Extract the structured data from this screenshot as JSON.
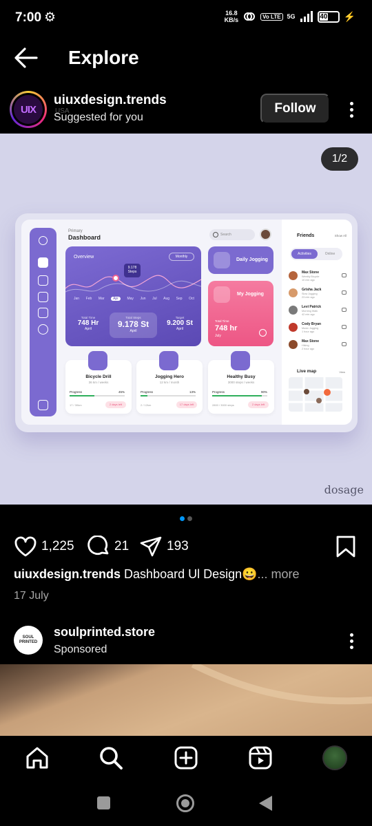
{
  "status_bar": {
    "time": "7:00",
    "net_speed_top": "16.8",
    "net_speed_bottom": "KB/s",
    "volte": "Vo LTE",
    "network": "5G",
    "battery": "40"
  },
  "header": {
    "title": "Explore"
  },
  "post1": {
    "username": "uiuxdesign.trends",
    "subtitle": "Suggested for you",
    "location_hint": "USA",
    "avatar_text": "UIX",
    "follow_label": "Follow",
    "image_counter": "1/2",
    "watermark": "dosage",
    "likes": "1,225",
    "comments": "21",
    "shares": "193",
    "caption_user": "uiuxdesign.trends",
    "caption_text": "Dashboard Ul Design😀",
    "caption_more": "... more",
    "date": "17 July",
    "carousel_count": 2,
    "carousel_active": 1
  },
  "dashboard": {
    "crumb": "Primary",
    "title": "Dashboard",
    "search": "Search",
    "overview": "Overview",
    "period": "Monthly",
    "tooltip_value": "9.178",
    "tooltip_unit": "Steps",
    "months": [
      "Jan",
      "Feb",
      "Mar",
      "Apr",
      "May",
      "Jun",
      "Jul",
      "Aug",
      "Sep",
      "Oct"
    ],
    "active_month": "Apr",
    "stats": [
      {
        "label": "Total Time",
        "value": "748 Hr",
        "month": "April"
      },
      {
        "label": "Total Steps",
        "value": "9.178 St",
        "month": "April"
      },
      {
        "label": "Target",
        "value": "9.200 St",
        "month": "April"
      }
    ],
    "daily_jogging": "Daily Jogging",
    "my_jogging": "My Jogging",
    "my_jogging_label": "Total Time",
    "my_jogging_value": "748 hr",
    "my_jogging_month": "July",
    "cards": [
      {
        "name": "Bicycle Drill",
        "sub": "36 km / weeks",
        "progress_label": "Progress",
        "progress_text": "45%",
        "progress": 0.45,
        "date": "17 / 30km",
        "days": "2 days left"
      },
      {
        "name": "Jogging Hero",
        "sub": "12 km / month",
        "progress_label": "Progress",
        "progress_text": "13%",
        "progress": 0.13,
        "date": "2 / 12km",
        "days": "17 days left"
      },
      {
        "name": "Healthy Busy",
        "sub": "3000 steps / weeks",
        "progress_label": "Progress",
        "progress_text": "90%",
        "progress": 0.9,
        "date": "2800 / 3000 steps",
        "days": "2 days left"
      }
    ],
    "friends_title": "Friends",
    "see_all": "Show All",
    "tab_active": "Activities",
    "tab_other": "Online",
    "friends": [
      {
        "name": "Max Stone",
        "status": "Weekly Bicycle",
        "time": "10 min ago",
        "color": "#b5643c"
      },
      {
        "name": "Grisha Jack",
        "status": "Slow Jogging",
        "time": "23 min ago",
        "color": "#d79a6a"
      },
      {
        "name": "Levi Patrick",
        "status": "Morning Walk",
        "time": "42 min ago",
        "color": "#7a7a7a"
      },
      {
        "name": "Cody Bryan",
        "status": "Music Jogging",
        "time": "1 hour ago",
        "color": "#c0392b"
      },
      {
        "name": "Max Stone",
        "status": "Hiking",
        "time": "2 hour ago",
        "color": "#8b4a2b"
      }
    ],
    "live_map": "Live map",
    "live_map_link": "View"
  },
  "post2": {
    "username": "soulprinted.store",
    "subtitle": "Sponsored",
    "avatar_text": "SOUL PRINTED"
  },
  "colors": {
    "accent": "#7b6ad0",
    "pink": "#ef5b8a",
    "blue_dot": "#0095f6",
    "image_bg": "#d4d4ea"
  },
  "nav": {
    "icons": [
      "home-icon",
      "search-icon",
      "create-icon",
      "reels-icon",
      "profile-avatar"
    ]
  },
  "system_nav": {
    "icons": [
      "recents-square-icon",
      "home-circle-icon",
      "back-triangle-icon"
    ]
  }
}
